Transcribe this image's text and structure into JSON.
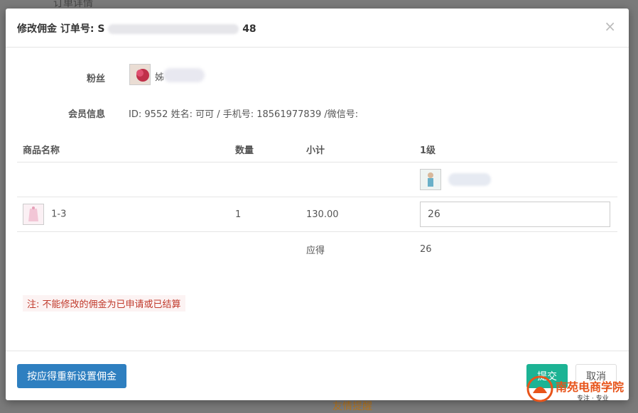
{
  "backdrop": {
    "top_text": "订单详情",
    "bottom_text": "友情提醒"
  },
  "modal": {
    "title": "修改佣金 订单号: S",
    "title_suffix": "48",
    "fans_label": "粉丝",
    "fans_name_initial": "姊",
    "member_label": "会员信息",
    "member_info": "ID: 9552 姓名: 可可 / 手机号: 18561977839 /微信号:",
    "table": {
      "headers": [
        "商品名称",
        "数量",
        "小计",
        "1级"
      ],
      "row": {
        "product": "1-3",
        "quantity": "1",
        "subtotal": "130.00",
        "level1_value": "26"
      },
      "summary": {
        "label": "应得",
        "value": "26"
      }
    },
    "note": "注: 不能修改的佣金为已申请或已结算",
    "buttons": {
      "reset": "按应得重新设置佣金",
      "submit": "提交",
      "cancel": "取消"
    }
  },
  "watermark": {
    "text": "南苑电商学院",
    "sub": "专注 · 专业"
  },
  "colors": {
    "primary": "#2e7fc0",
    "success": "#1cb394",
    "danger": "#c0392b",
    "watermark": "#e8541a"
  }
}
